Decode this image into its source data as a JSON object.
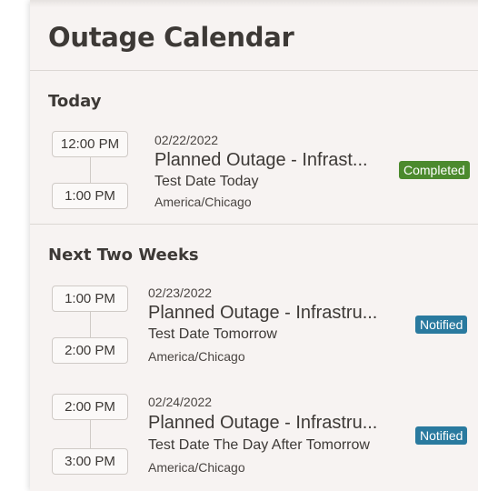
{
  "page": {
    "title": "Outage Calendar"
  },
  "colors": {
    "completed": "#4c8a2e",
    "notified": "#2a7a9f"
  },
  "sections": [
    {
      "title": "Today",
      "items": [
        {
          "start_time": "12:00 PM",
          "end_time": "1:00 PM",
          "date": "02/22/2022",
          "title": "Planned Outage - Infrast...",
          "subtitle": "Test Date Today",
          "timezone": "America/Chicago",
          "status": "Completed"
        }
      ]
    },
    {
      "title": "Next Two Weeks",
      "items": [
        {
          "start_time": "1:00 PM",
          "end_time": "2:00 PM",
          "date": "02/23/2022",
          "title": "Planned Outage - Infrastru...",
          "subtitle": "Test Date Tomorrow",
          "timezone": "America/Chicago",
          "status": "Notified"
        },
        {
          "start_time": "2:00 PM",
          "end_time": "3:00 PM",
          "date": "02/24/2022",
          "title": "Planned Outage - Infrastru...",
          "subtitle": "Test Date The Day After Tomorrow",
          "timezone": "America/Chicago",
          "status": "Notified"
        }
      ]
    }
  ]
}
